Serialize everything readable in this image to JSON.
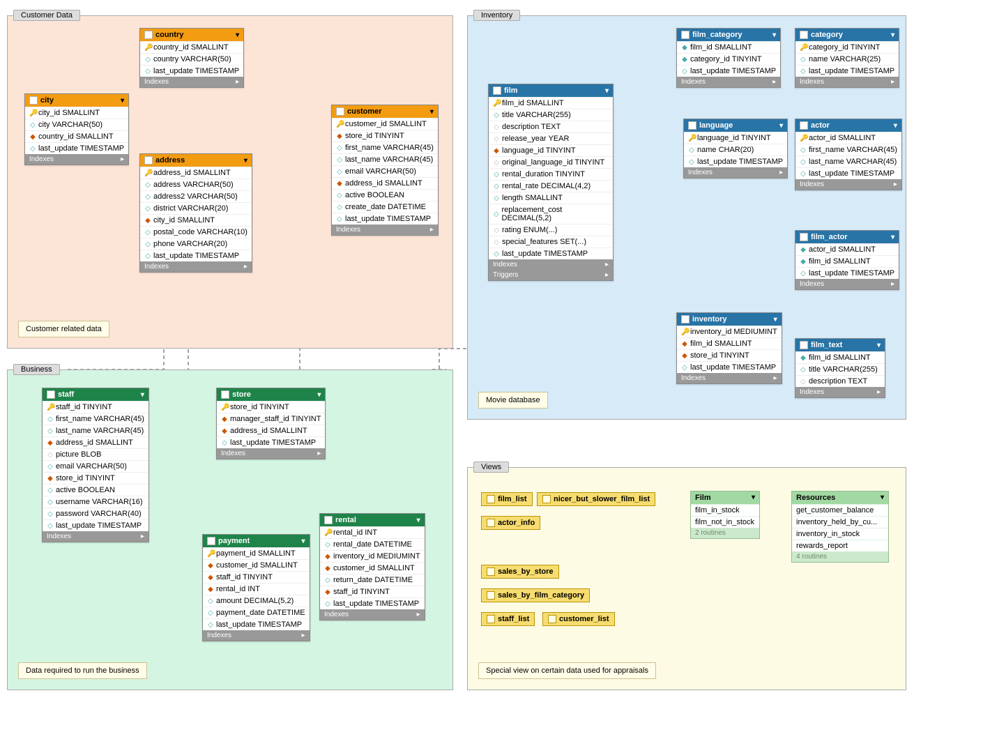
{
  "regions": {
    "customer": {
      "title": "Customer Data",
      "note": "Customer related data"
    },
    "inventory": {
      "title": "Inventory",
      "note": "Movie database"
    },
    "business": {
      "title": "Business",
      "note": "Data required to run the business"
    },
    "views": {
      "title": "Views",
      "note": "Special view on certain data used for appraisals"
    }
  },
  "sections": {
    "indexes": "Indexes",
    "triggers": "Triggers"
  },
  "tables": {
    "country": {
      "name": "country",
      "cols": [
        {
          "i": "k",
          "t": "country_id SMALLINT"
        },
        {
          "i": "c",
          "t": "country VARCHAR(50)"
        },
        {
          "i": "c",
          "t": "last_update TIMESTAMP"
        }
      ]
    },
    "city": {
      "name": "city",
      "cols": [
        {
          "i": "k",
          "t": "city_id SMALLINT"
        },
        {
          "i": "c",
          "t": "city VARCHAR(50)"
        },
        {
          "i": "f",
          "t": "country_id SMALLINT"
        },
        {
          "i": "c",
          "t": "last_update TIMESTAMP"
        }
      ]
    },
    "address": {
      "name": "address",
      "cols": [
        {
          "i": "k",
          "t": "address_id SMALLINT"
        },
        {
          "i": "c",
          "t": "address VARCHAR(50)"
        },
        {
          "i": "c",
          "t": "address2 VARCHAR(50)"
        },
        {
          "i": "c",
          "t": "district VARCHAR(20)"
        },
        {
          "i": "f",
          "t": "city_id SMALLINT"
        },
        {
          "i": "c",
          "t": "postal_code VARCHAR(10)"
        },
        {
          "i": "c",
          "t": "phone VARCHAR(20)"
        },
        {
          "i": "c",
          "t": "last_update TIMESTAMP"
        }
      ]
    },
    "customer": {
      "name": "customer",
      "cols": [
        {
          "i": "k",
          "t": "customer_id SMALLINT"
        },
        {
          "i": "f",
          "t": "store_id TINYINT"
        },
        {
          "i": "c",
          "t": "first_name VARCHAR(45)"
        },
        {
          "i": "c",
          "t": "last_name VARCHAR(45)"
        },
        {
          "i": "c",
          "t": "email VARCHAR(50)"
        },
        {
          "i": "f",
          "t": "address_id SMALLINT"
        },
        {
          "i": "c",
          "t": "active BOOLEAN"
        },
        {
          "i": "c",
          "t": "create_date DATETIME"
        },
        {
          "i": "c",
          "t": "last_update TIMESTAMP"
        }
      ]
    },
    "film": {
      "name": "film",
      "cols": [
        {
          "i": "k",
          "t": "film_id SMALLINT"
        },
        {
          "i": "c",
          "t": "title VARCHAR(255)"
        },
        {
          "i": "n",
          "t": "description TEXT"
        },
        {
          "i": "n",
          "t": "release_year YEAR"
        },
        {
          "i": "f",
          "t": "language_id TINYINT"
        },
        {
          "i": "n",
          "t": "original_language_id TINYINT"
        },
        {
          "i": "c",
          "t": "rental_duration TINYINT"
        },
        {
          "i": "c",
          "t": "rental_rate DECIMAL(4,2)"
        },
        {
          "i": "c",
          "t": "length SMALLINT"
        },
        {
          "i": "c",
          "t": "replacement_cost DECIMAL(5,2)"
        },
        {
          "i": "n",
          "t": "rating ENUM(...)"
        },
        {
          "i": "n",
          "t": "special_features SET(...)"
        },
        {
          "i": "c",
          "t": "last_update TIMESTAMP"
        }
      ]
    },
    "film_category": {
      "name": "film_category",
      "cols": [
        {
          "i": "p",
          "t": "film_id SMALLINT"
        },
        {
          "i": "p",
          "t": "category_id TINYINT"
        },
        {
          "i": "c",
          "t": "last_update TIMESTAMP"
        }
      ]
    },
    "category": {
      "name": "category",
      "cols": [
        {
          "i": "k",
          "t": "category_id TINYINT"
        },
        {
          "i": "c",
          "t": "name VARCHAR(25)"
        },
        {
          "i": "c",
          "t": "last_update TIMESTAMP"
        }
      ]
    },
    "language": {
      "name": "language",
      "cols": [
        {
          "i": "k",
          "t": "language_id TINYINT"
        },
        {
          "i": "c",
          "t": "name CHAR(20)"
        },
        {
          "i": "c",
          "t": "last_update TIMESTAMP"
        }
      ]
    },
    "actor": {
      "name": "actor",
      "cols": [
        {
          "i": "k",
          "t": "actor_id SMALLINT"
        },
        {
          "i": "c",
          "t": "first_name VARCHAR(45)"
        },
        {
          "i": "c",
          "t": "last_name VARCHAR(45)"
        },
        {
          "i": "c",
          "t": "last_update TIMESTAMP"
        }
      ]
    },
    "film_actor": {
      "name": "film_actor",
      "cols": [
        {
          "i": "p",
          "t": "actor_id SMALLINT"
        },
        {
          "i": "p",
          "t": "film_id SMALLINT"
        },
        {
          "i": "c",
          "t": "last_update TIMESTAMP"
        }
      ]
    },
    "inventory": {
      "name": "inventory",
      "cols": [
        {
          "i": "k",
          "t": "inventory_id MEDIUMINT"
        },
        {
          "i": "f",
          "t": "film_id SMALLINT"
        },
        {
          "i": "f",
          "t": "store_id TINYINT"
        },
        {
          "i": "c",
          "t": "last_update TIMESTAMP"
        }
      ]
    },
    "film_text": {
      "name": "film_text",
      "cols": [
        {
          "i": "p",
          "t": "film_id SMALLINT"
        },
        {
          "i": "c",
          "t": "title VARCHAR(255)"
        },
        {
          "i": "n",
          "t": "description TEXT"
        }
      ]
    },
    "staff": {
      "name": "staff",
      "cols": [
        {
          "i": "k",
          "t": "staff_id TINYINT"
        },
        {
          "i": "c",
          "t": "first_name VARCHAR(45)"
        },
        {
          "i": "c",
          "t": "last_name VARCHAR(45)"
        },
        {
          "i": "f",
          "t": "address_id SMALLINT"
        },
        {
          "i": "n",
          "t": "picture BLOB"
        },
        {
          "i": "c",
          "t": "email VARCHAR(50)"
        },
        {
          "i": "f",
          "t": "store_id TINYINT"
        },
        {
          "i": "c",
          "t": "active BOOLEAN"
        },
        {
          "i": "c",
          "t": "username VARCHAR(16)"
        },
        {
          "i": "c",
          "t": "password VARCHAR(40)"
        },
        {
          "i": "c",
          "t": "last_update TIMESTAMP"
        }
      ]
    },
    "store": {
      "name": "store",
      "cols": [
        {
          "i": "k",
          "t": "store_id TINYINT"
        },
        {
          "i": "f",
          "t": "manager_staff_id TINYINT"
        },
        {
          "i": "f",
          "t": "address_id SMALLINT"
        },
        {
          "i": "c",
          "t": "last_update TIMESTAMP"
        }
      ]
    },
    "payment": {
      "name": "payment",
      "cols": [
        {
          "i": "k",
          "t": "payment_id SMALLINT"
        },
        {
          "i": "f",
          "t": "customer_id SMALLINT"
        },
        {
          "i": "f",
          "t": "staff_id TINYINT"
        },
        {
          "i": "f",
          "t": "rental_id INT"
        },
        {
          "i": "c",
          "t": "amount DECIMAL(5,2)"
        },
        {
          "i": "c",
          "t": "payment_date DATETIME"
        },
        {
          "i": "c",
          "t": "last_update TIMESTAMP"
        }
      ]
    },
    "rental": {
      "name": "rental",
      "cols": [
        {
          "i": "k",
          "t": "rental_id INT"
        },
        {
          "i": "c",
          "t": "rental_date DATETIME"
        },
        {
          "i": "f",
          "t": "inventory_id MEDIUMINT"
        },
        {
          "i": "f",
          "t": "customer_id SMALLINT"
        },
        {
          "i": "c",
          "t": "return_date DATETIME"
        },
        {
          "i": "f",
          "t": "staff_id TINYINT"
        },
        {
          "i": "c",
          "t": "last_update TIMESTAMP"
        }
      ]
    }
  },
  "views": {
    "items": [
      "film_list",
      "nicer_but_slower_film_list",
      "actor_info",
      "sales_by_store",
      "sales_by_film_category",
      "staff_list",
      "customer_list"
    ]
  },
  "routines": {
    "film": {
      "title": "Film",
      "items": [
        "film_in_stock",
        "film_not_in_stock"
      ],
      "footer": "2 routines"
    },
    "resources": {
      "title": "Resources",
      "items": [
        "get_customer_balance",
        "inventory_held_by_cu...",
        "inventory_in_stock",
        "rewards_report"
      ],
      "footer": "4 routines"
    }
  }
}
